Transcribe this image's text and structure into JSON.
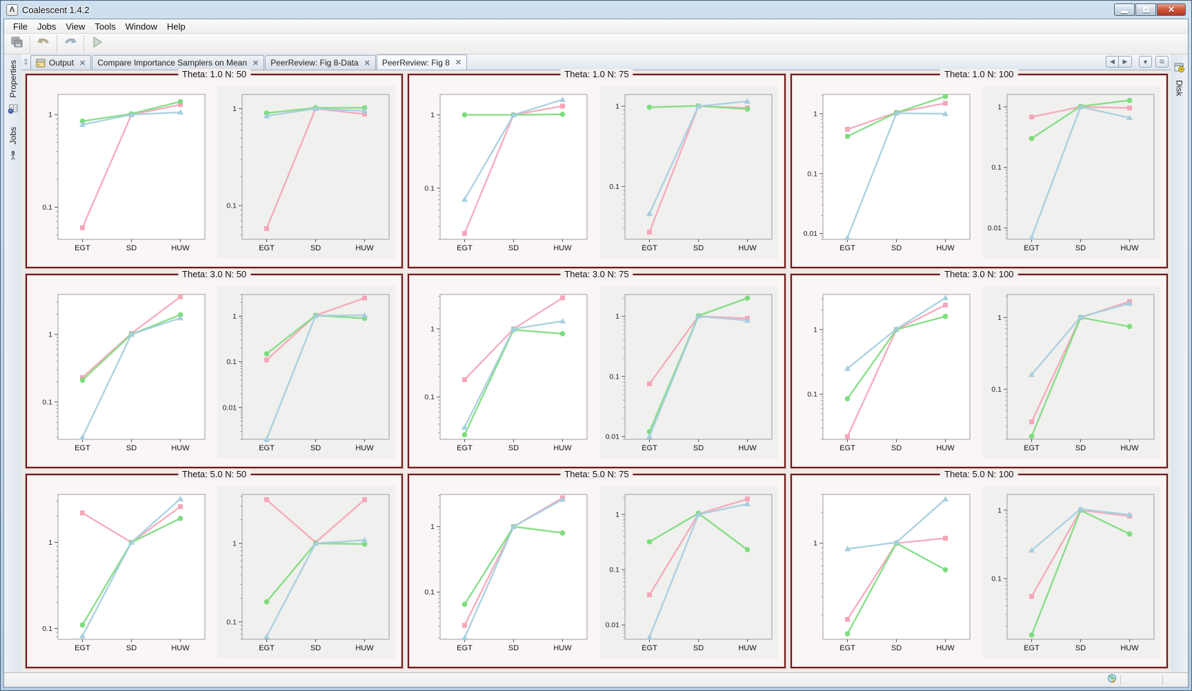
{
  "window": {
    "title": "Coalescent 1.4.2"
  },
  "menu": {
    "items": [
      "File",
      "Jobs",
      "View",
      "Tools",
      "Window",
      "Help"
    ]
  },
  "toolbar": {
    "buttons": [
      {
        "icon": "copy-icon"
      },
      {
        "icon": "undo-icon"
      },
      {
        "icon": "redo-icon"
      },
      {
        "icon": "run-icon"
      }
    ]
  },
  "tabs": {
    "items": [
      {
        "label": "Output",
        "icon": "output-window-icon",
        "active": false
      },
      {
        "label": "Compare Importance Samplers on Mean",
        "active": false
      },
      {
        "label": "PeerReview: Fig 8-Data",
        "active": false
      },
      {
        "label": "PeerReview: Fig 8",
        "active": true
      }
    ],
    "controls": [
      "scroll-left-icon",
      "scroll-right-icon",
      "tab-list-dropdown-icon",
      "maximize-view-icon"
    ]
  },
  "left_rail": {
    "items": [
      {
        "label": "Properties",
        "icon": "properties-icon"
      },
      {
        "label": "Jobs",
        "icon": "jobs-icon"
      }
    ]
  },
  "right_rail": {
    "items": [
      {
        "label": "Disk",
        "icon": "disk-icon"
      }
    ]
  },
  "statusbar": {
    "icons": [
      "globe-refresh-icon"
    ]
  },
  "colors": {
    "panel_border": "#6f1b1b",
    "series_pink": "#f5a6b8",
    "series_green": "#7edc7e",
    "series_blue": "#a6cede",
    "plot_white": "#ffffff",
    "plot_gray": "#f0f0ee"
  },
  "chart_data": [
    {
      "title": "Theta: 1.0 N: 50",
      "type": "line",
      "categories": [
        "EGT",
        "SD",
        "HUW"
      ],
      "charts": [
        {
          "plot_bg": "#ffffff",
          "yticks": [
            1,
            0.1
          ],
          "ylim": [
            0.045,
            1.65
          ],
          "series": [
            {
              "name": "pink",
              "color": "#f5a6b8",
              "marker": "square",
              "values": [
                0.06,
                1.0,
                1.28
              ]
            },
            {
              "name": "green",
              "color": "#7edc7e",
              "marker": "circle",
              "values": [
                0.85,
                1.02,
                1.38
              ]
            },
            {
              "name": "blue",
              "color": "#a6cede",
              "marker": "triangle",
              "values": [
                0.78,
                1.0,
                1.06
              ]
            }
          ]
        },
        {
          "plot_bg": "#f0f0ee",
          "yticks": [
            1,
            0.1
          ],
          "ylim": [
            0.045,
            1.4
          ],
          "series": [
            {
              "name": "pink",
              "color": "#f5a6b8",
              "marker": "square",
              "values": [
                0.058,
                1.0,
                0.88
              ]
            },
            {
              "name": "green",
              "color": "#7edc7e",
              "marker": "circle",
              "values": [
                0.9,
                1.02,
                1.02
              ]
            },
            {
              "name": "blue",
              "color": "#a6cede",
              "marker": "triangle",
              "values": [
                0.84,
                1.0,
                0.95
              ]
            }
          ]
        }
      ]
    },
    {
      "title": "Theta: 1.0 N: 75",
      "type": "line",
      "categories": [
        "EGT",
        "SD",
        "HUW"
      ],
      "charts": [
        {
          "plot_bg": "#ffffff",
          "yticks": [
            1,
            0.1
          ],
          "ylim": [
            0.02,
            1.9
          ],
          "series": [
            {
              "name": "pink",
              "color": "#f5a6b8",
              "marker": "square",
              "values": [
                0.024,
                1.0,
                1.32
              ]
            },
            {
              "name": "green",
              "color": "#7edc7e",
              "marker": "circle",
              "values": [
                1.0,
                1.0,
                1.02
              ]
            },
            {
              "name": "blue",
              "color": "#a6cede",
              "marker": "triangle",
              "values": [
                0.07,
                1.0,
                1.62
              ]
            }
          ]
        },
        {
          "plot_bg": "#f0f0ee",
          "yticks": [
            1,
            0.1
          ],
          "ylim": [
            0.022,
            1.4
          ],
          "series": [
            {
              "name": "pink",
              "color": "#f5a6b8",
              "marker": "square",
              "values": [
                0.027,
                1.0,
                0.95
              ]
            },
            {
              "name": "green",
              "color": "#7edc7e",
              "marker": "circle",
              "values": [
                0.97,
                1.01,
                0.92
              ]
            },
            {
              "name": "blue",
              "color": "#a6cede",
              "marker": "triangle",
              "values": [
                0.046,
                1.0,
                1.15
              ]
            }
          ]
        }
      ]
    },
    {
      "title": "Theta: 1.0 N: 100",
      "type": "line",
      "categories": [
        "EGT",
        "SD",
        "HUW"
      ],
      "charts": [
        {
          "plot_bg": "#ffffff",
          "yticks": [
            1,
            0.1,
            0.01
          ],
          "ylim": [
            0.008,
            2.1
          ],
          "series": [
            {
              "name": "pink",
              "color": "#f5a6b8",
              "marker": "square",
              "values": [
                0.55,
                1.05,
                1.5
              ]
            },
            {
              "name": "green",
              "color": "#7edc7e",
              "marker": "circle",
              "values": [
                0.42,
                1.04,
                1.95
              ]
            },
            {
              "name": "blue",
              "color": "#a6cede",
              "marker": "triangle",
              "values": [
                0.0085,
                1.02,
                1.0
              ]
            }
          ]
        },
        {
          "plot_bg": "#f0f0ee",
          "yticks": [
            1,
            0.1,
            0.01
          ],
          "ylim": [
            0.0065,
            1.6
          ],
          "series": [
            {
              "name": "pink",
              "color": "#f5a6b8",
              "marker": "square",
              "values": [
                0.68,
                1.0,
                0.96
              ]
            },
            {
              "name": "green",
              "color": "#7edc7e",
              "marker": "circle",
              "values": [
                0.3,
                1.02,
                1.28
              ]
            },
            {
              "name": "blue",
              "color": "#a6cede",
              "marker": "triangle",
              "values": [
                0.007,
                1.0,
                0.66
              ]
            }
          ]
        }
      ]
    },
    {
      "title": "Theta: 3.0 N: 50",
      "type": "line",
      "categories": [
        "EGT",
        "SD",
        "HUW"
      ],
      "charts": [
        {
          "plot_bg": "#ffffff",
          "yticks": [
            1,
            0.1
          ],
          "ylim": [
            0.028,
            3.9
          ],
          "series": [
            {
              "name": "pink",
              "color": "#f5a6b8",
              "marker": "square",
              "values": [
                0.23,
                1.03,
                3.6
              ]
            },
            {
              "name": "green",
              "color": "#7edc7e",
              "marker": "circle",
              "values": [
                0.21,
                1.0,
                1.95
              ]
            },
            {
              "name": "blue",
              "color": "#a6cede",
              "marker": "triangle",
              "values": [
                0.03,
                1.0,
                1.75
              ]
            }
          ]
        },
        {
          "plot_bg": "#f0f0ee",
          "yticks": [
            1,
            0.1,
            0.01
          ],
          "ylim": [
            0.002,
            3.0
          ],
          "series": [
            {
              "name": "pink",
              "color": "#f5a6b8",
              "marker": "square",
              "values": [
                0.11,
                1.04,
                2.5
              ]
            },
            {
              "name": "green",
              "color": "#7edc7e",
              "marker": "circle",
              "values": [
                0.15,
                1.04,
                0.9
              ]
            },
            {
              "name": "blue",
              "color": "#a6cede",
              "marker": "triangle",
              "values": [
                0.002,
                1.03,
                1.05
              ]
            }
          ]
        }
      ]
    },
    {
      "title": "Theta: 3.0 N: 75",
      "type": "line",
      "categories": [
        "EGT",
        "SD",
        "HUW"
      ],
      "charts": [
        {
          "plot_bg": "#ffffff",
          "yticks": [
            1,
            0.1
          ],
          "ylim": [
            0.024,
            3.2
          ],
          "series": [
            {
              "name": "pink",
              "color": "#f5a6b8",
              "marker": "square",
              "values": [
                0.18,
                1.0,
                2.85
              ]
            },
            {
              "name": "green",
              "color": "#7edc7e",
              "marker": "circle",
              "values": [
                0.028,
                0.97,
                0.85
              ]
            },
            {
              "name": "blue",
              "color": "#a6cede",
              "marker": "triangle",
              "values": [
                0.036,
                1.0,
                1.3
              ]
            }
          ]
        },
        {
          "plot_bg": "#f0f0ee",
          "yticks": [
            1,
            0.1,
            0.01
          ],
          "ylim": [
            0.009,
            2.3
          ],
          "series": [
            {
              "name": "pink",
              "color": "#f5a6b8",
              "marker": "square",
              "values": [
                0.075,
                1.0,
                0.92
              ]
            },
            {
              "name": "green",
              "color": "#7edc7e",
              "marker": "circle",
              "values": [
                0.012,
                1.02,
                2.0
              ]
            },
            {
              "name": "blue",
              "color": "#a6cede",
              "marker": "triangle",
              "values": [
                0.01,
                1.0,
                0.85
              ]
            }
          ]
        }
      ]
    },
    {
      "title": "Theta: 3.0 N: 100",
      "type": "line",
      "categories": [
        "EGT",
        "SD",
        "HUW"
      ],
      "charts": [
        {
          "plot_bg": "#ffffff",
          "yticks": [
            1,
            0.1
          ],
          "ylim": [
            0.02,
            3.5
          ],
          "series": [
            {
              "name": "pink",
              "color": "#f5a6b8",
              "marker": "square",
              "values": [
                0.022,
                1.0,
                2.4
              ]
            },
            {
              "name": "green",
              "color": "#7edc7e",
              "marker": "circle",
              "values": [
                0.085,
                1.0,
                1.6
              ]
            },
            {
              "name": "blue",
              "color": "#a6cede",
              "marker": "triangle",
              "values": [
                0.25,
                1.02,
                3.1
              ]
            }
          ]
        },
        {
          "plot_bg": "#f0f0ee",
          "yticks": [
            1,
            0.1
          ],
          "ylim": [
            0.02,
            2.1
          ],
          "series": [
            {
              "name": "pink",
              "color": "#f5a6b8",
              "marker": "square",
              "values": [
                0.035,
                1.0,
                1.68
              ]
            },
            {
              "name": "green",
              "color": "#7edc7e",
              "marker": "circle",
              "values": [
                0.022,
                1.0,
                0.75
              ]
            },
            {
              "name": "blue",
              "color": "#a6cede",
              "marker": "triangle",
              "values": [
                0.16,
                1.02,
                1.58
              ]
            }
          ]
        }
      ]
    },
    {
      "title": "Theta: 5.0 N: 50",
      "type": "line",
      "categories": [
        "EGT",
        "SD",
        "HUW"
      ],
      "charts": [
        {
          "plot_bg": "#ffffff",
          "yticks": [
            1,
            0.1
          ],
          "ylim": [
            0.075,
            3.6
          ],
          "series": [
            {
              "name": "pink",
              "color": "#f5a6b8",
              "marker": "square",
              "values": [
                2.2,
                1.0,
                2.6
              ]
            },
            {
              "name": "green",
              "color": "#7edc7e",
              "marker": "circle",
              "values": [
                0.11,
                1.0,
                1.9
              ]
            },
            {
              "name": "blue",
              "color": "#a6cede",
              "marker": "triangle",
              "values": [
                0.082,
                1.0,
                3.2
              ]
            }
          ]
        },
        {
          "plot_bg": "#f0f0ee",
          "yticks": [
            1,
            0.1
          ],
          "ylim": [
            0.06,
            4.2
          ],
          "series": [
            {
              "name": "pink",
              "color": "#f5a6b8",
              "marker": "square",
              "values": [
                3.6,
                1.03,
                3.6
              ]
            },
            {
              "name": "green",
              "color": "#7edc7e",
              "marker": "circle",
              "values": [
                0.18,
                1.0,
                0.98
              ]
            },
            {
              "name": "blue",
              "color": "#a6cede",
              "marker": "triangle",
              "values": [
                0.065,
                1.0,
                1.1
              ]
            }
          ]
        }
      ]
    },
    {
      "title": "Theta: 5.0 N: 75",
      "type": "line",
      "categories": [
        "EGT",
        "SD",
        "HUW"
      ],
      "charts": [
        {
          "plot_bg": "#ffffff",
          "yticks": [
            1,
            0.1
          ],
          "ylim": [
            0.019,
            3.1
          ],
          "series": [
            {
              "name": "pink",
              "color": "#f5a6b8",
              "marker": "square",
              "values": [
                0.031,
                1.0,
                2.75
              ]
            },
            {
              "name": "green",
              "color": "#7edc7e",
              "marker": "circle",
              "values": [
                0.065,
                1.0,
                0.8
              ]
            },
            {
              "name": "blue",
              "color": "#a6cede",
              "marker": "triangle",
              "values": [
                0.02,
                1.0,
                2.6
              ]
            }
          ]
        },
        {
          "plot_bg": "#f0f0ee",
          "yticks": [
            1,
            0.1,
            0.01
          ],
          "ylim": [
            0.0055,
            2.3
          ],
          "series": [
            {
              "name": "pink",
              "color": "#f5a6b8",
              "marker": "square",
              "values": [
                0.035,
                1.02,
                1.9
              ]
            },
            {
              "name": "green",
              "color": "#7edc7e",
              "marker": "circle",
              "values": [
                0.32,
                1.05,
                0.23
              ]
            },
            {
              "name": "blue",
              "color": "#a6cede",
              "marker": "triangle",
              "values": [
                0.006,
                1.0,
                1.55
              ]
            }
          ]
        }
      ]
    },
    {
      "title": "Theta: 5.0 N: 100",
      "type": "line",
      "categories": [
        "EGT",
        "SD",
        "HUW"
      ],
      "charts": [
        {
          "plot_bg": "#ffffff",
          "yticks": [
            1
          ],
          "ylim": [
            0.115,
            3.0
          ],
          "series": [
            {
              "name": "pink",
              "color": "#f5a6b8",
              "marker": "square",
              "values": [
                0.18,
                1.0,
                1.12
              ]
            },
            {
              "name": "green",
              "color": "#7edc7e",
              "marker": "circle",
              "values": [
                0.13,
                1.0,
                0.55
              ]
            },
            {
              "name": "blue",
              "color": "#a6cede",
              "marker": "triangle",
              "values": [
                0.88,
                1.02,
                2.7
              ]
            }
          ]
        },
        {
          "plot_bg": "#f0f0ee",
          "yticks": [
            1,
            0.1
          ],
          "ylim": [
            0.013,
            1.7
          ],
          "series": [
            {
              "name": "pink",
              "color": "#f5a6b8",
              "marker": "square",
              "values": [
                0.055,
                1.0,
                0.82
              ]
            },
            {
              "name": "green",
              "color": "#7edc7e",
              "marker": "circle",
              "values": [
                0.015,
                1.0,
                0.45
              ]
            },
            {
              "name": "blue",
              "color": "#a6cede",
              "marker": "triangle",
              "values": [
                0.26,
                1.04,
                0.86
              ]
            }
          ]
        }
      ]
    }
  ]
}
